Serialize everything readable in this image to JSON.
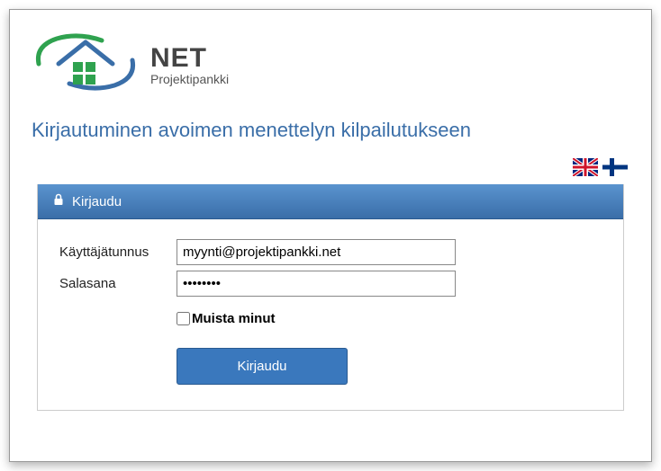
{
  "logo": {
    "main": "NET",
    "sub": "Projektipankki"
  },
  "page_title": "Kirjautuminen avoimen menettelyn kilpailutukseen",
  "flags": {
    "uk": "flag-uk",
    "fi": "flag-fi"
  },
  "panel": {
    "header": "Kirjaudu"
  },
  "form": {
    "username_label": "Käyttäjätunnus",
    "username_value": "myynti@projektipankki.net",
    "password_label": "Salasana",
    "password_value": "••••••••",
    "remember_label": "Muista minut",
    "submit_label": "Kirjaudu"
  }
}
